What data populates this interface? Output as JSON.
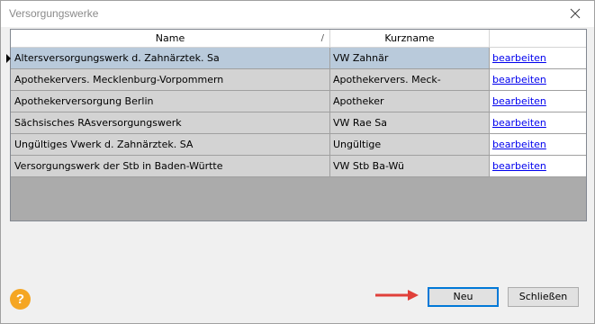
{
  "window": {
    "title": "Versorgungswerke"
  },
  "grid": {
    "columns": [
      {
        "label": "Name",
        "sort_indicator": "/"
      },
      {
        "label": "Kurzname"
      },
      {
        "label": ""
      }
    ],
    "rows": [
      {
        "name": "Altersversorgungswerk d. Zahnärztek. Sa",
        "kurzname": "VW Zahnär",
        "action": "bearbeiten",
        "selected": true
      },
      {
        "name": "Apothekervers. Mecklenburg-Vorpommern",
        "kurzname": "Apothekervers. Meck-",
        "action": "bearbeiten"
      },
      {
        "name": "Apothekerversorgung Berlin",
        "kurzname": "Apotheker",
        "action": "bearbeiten"
      },
      {
        "name": "Sächsisches RAsversorgungswerk",
        "kurzname": "VW Rae Sa",
        "action": "bearbeiten"
      },
      {
        "name": "Ungültiges Vwerk d. Zahnärztek. SA",
        "kurzname": "Ungültige",
        "action": "bearbeiten"
      },
      {
        "name": "Versorgungswerk der Stb in Baden-Württe",
        "kurzname": "VW Stb Ba-Wü",
        "action": "bearbeiten"
      }
    ]
  },
  "footer": {
    "help_glyph": "?",
    "new_label": "Neu",
    "close_label": "Schließen"
  },
  "colors": {
    "selected_row": "#b9cadb",
    "row": "#d3d3d3",
    "accent": "#0078d7",
    "help": "#f5a623",
    "arrow": "#e0403a"
  }
}
